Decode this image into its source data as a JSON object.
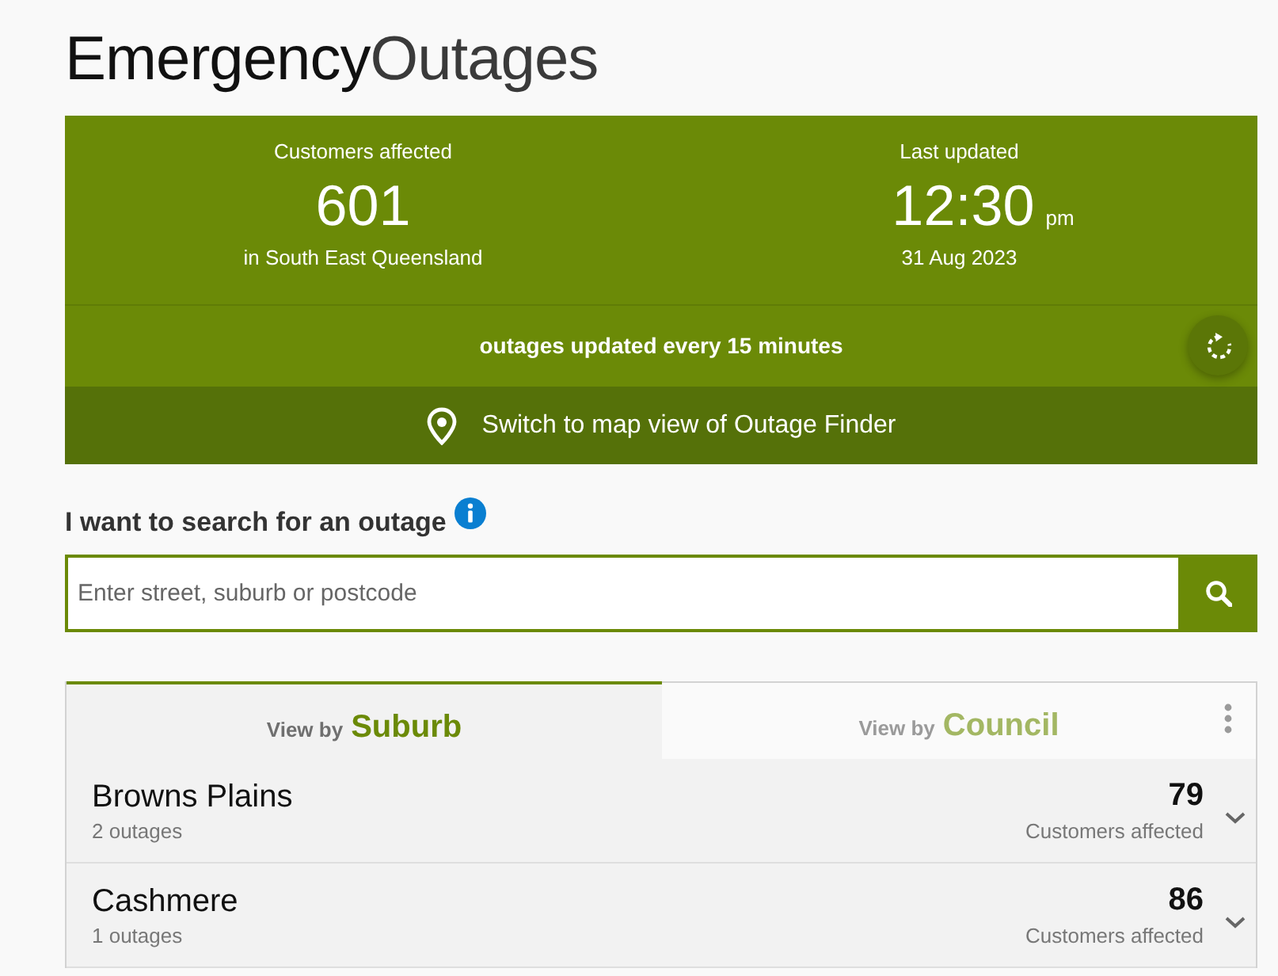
{
  "title": {
    "primary": "Emergency",
    "secondary": "Outages"
  },
  "summary": {
    "customers_label": "Customers affected",
    "customers_count": "601",
    "region": "in South East Queensland",
    "updated_label": "Last updated",
    "updated_time": "12:30",
    "updated_meridiem": "pm",
    "updated_date": "31 Aug 2023",
    "refresh_note": "outages updated every 15 minutes"
  },
  "map_link": "Switch to map view of Outage Finder",
  "search": {
    "label": "I want to search for an outage",
    "placeholder": "Enter street, suburb or postcode"
  },
  "tabs": [
    {
      "prefix": "View by",
      "label": "Suburb",
      "selected": true
    },
    {
      "prefix": "View by",
      "label": "Council",
      "selected": false
    }
  ],
  "outages": [
    {
      "name": "Browns Plains",
      "outage_count": "2 outages",
      "customers": "79",
      "customers_label": "Customers affected",
      "expanded": false
    },
    {
      "name": "Cashmere",
      "outage_count": "1 outages",
      "customers": "86",
      "customers_label": "Customers affected",
      "expanded": false
    }
  ]
}
